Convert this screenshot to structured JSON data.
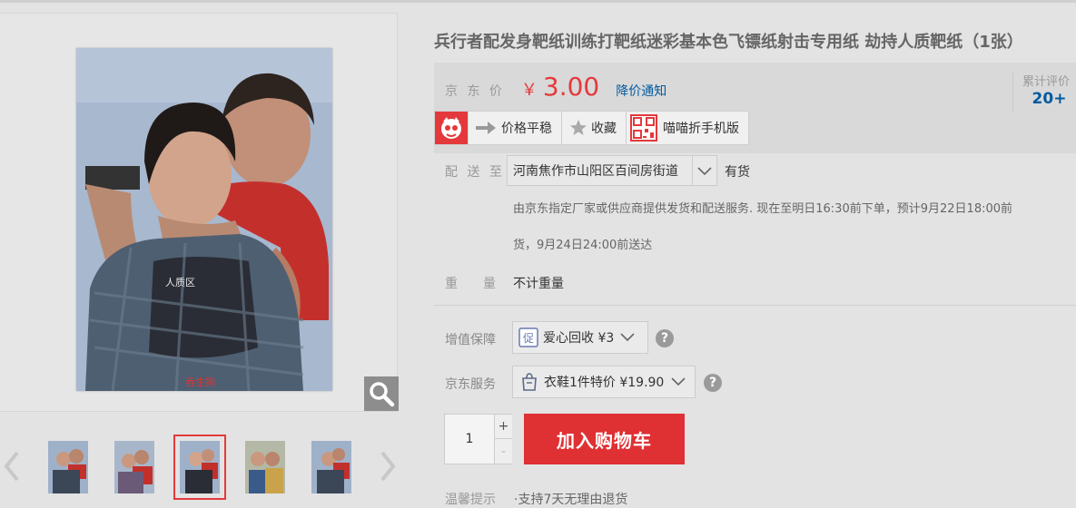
{
  "product": {
    "title": "兵行者配发身靶纸训练打靶纸迷彩基本色飞镖纸射击专用纸 劫持人质靶纸（1张）",
    "target_overlay_label": "人质区",
    "target_bottom_label": "吞生狗"
  },
  "price": {
    "label": "京 东 价",
    "currency": "￥",
    "value": "3.00",
    "notify_label": "降价通知"
  },
  "reviews": {
    "label": "累计评价",
    "count": "20+"
  },
  "tags": [
    {
      "icon": "red-mascot-icon",
      "label": ""
    },
    {
      "icon": "arrow-right-icon",
      "label": "价格平稳"
    },
    {
      "icon": "star-icon",
      "label": "收藏"
    },
    {
      "icon": "qr-code-icon",
      "label": "喵喵折手机版"
    }
  ],
  "delivery": {
    "label": "配 送 至",
    "address": "河南焦作市山阳区百间房街道",
    "stock": "有货",
    "note_line1": "由京东指定厂家或供应商提供发货和配送服务. 现在至明日16:30前下单，预计9月22日18:00前",
    "note_line2": "货，9月24日24:00前送达"
  },
  "weight": {
    "label": "重　　量",
    "value": "不计重量"
  },
  "services": {
    "guarantee_label": "增值保障",
    "guarantee_option": "爱心回收 ¥3",
    "jd_service_label": "京东服务",
    "jd_service_option": "衣鞋1件特价 ¥19.90"
  },
  "cart": {
    "quantity": "1",
    "plus": "+",
    "minus": "-",
    "add_label": "加入购物车"
  },
  "tips": {
    "label": "温馨提示",
    "text": "·支持7天无理由退货"
  },
  "colors": {
    "accent_red": "#e4393c",
    "link_blue": "#005aa0"
  }
}
